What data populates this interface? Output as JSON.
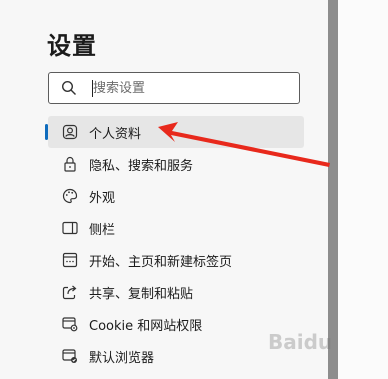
{
  "header": {
    "title": "设置"
  },
  "search": {
    "placeholder": "搜索设置",
    "value": ""
  },
  "nav": {
    "items": [
      {
        "label": "个人资料",
        "icon": "profile-icon",
        "active": true
      },
      {
        "label": "隐私、搜索和服务",
        "icon": "lock-icon"
      },
      {
        "label": "外观",
        "icon": "palette-icon"
      },
      {
        "label": "侧栏",
        "icon": "sidebar-icon"
      },
      {
        "label": "开始、主页和新建标签页",
        "icon": "home-tabs-icon"
      },
      {
        "label": "共享、复制和粘贴",
        "icon": "share-icon"
      },
      {
        "label": "Cookie 和网站权限",
        "icon": "site-permissions-icon"
      },
      {
        "label": "默认浏览器",
        "icon": "default-browser-icon"
      }
    ]
  },
  "annotation": {
    "color": "#e8291c"
  },
  "watermark": {
    "text": "Baidu"
  }
}
